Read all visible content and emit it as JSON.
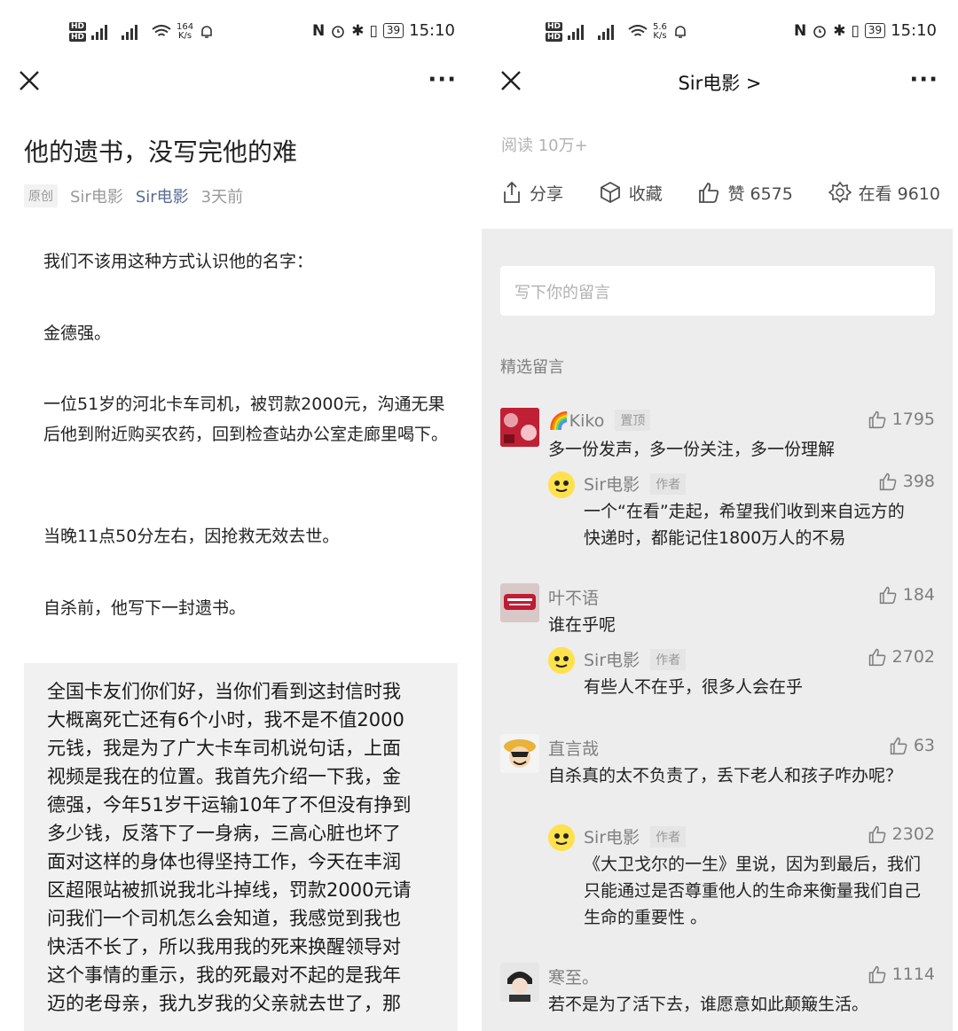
{
  "left": {
    "status": {
      "net_speed": "164",
      "net_unit": "K/s",
      "battery": "39",
      "time": "15:10"
    },
    "article": {
      "title": "他的遗书，没写完他的难",
      "original_tag": "原创",
      "author": "Sir电影",
      "account_link": "Sir电影",
      "time_ago": "3天前",
      "paragraphs": [
        "我们不该用这种方式认识他的名字：",
        "金德强。",
        "一位51岁的河北卡车司机，被罚款2000元，沟通无果后他到附近购买农药，回到检查站办公室走廊里喝下。",
        "当晚11点50分左右，因抢救无效去世。",
        "自杀前，他写下一封遗书。"
      ],
      "letter_lines": [
        "全国卡友们你们好，当你们看到这封信时我",
        "大概离死亡还有6个小时，我不是不值2000",
        "元钱，我是为了广大卡车司机说句话，上面",
        "视频是我在的位置。我首先介绍一下我，金",
        "德强，今年51岁干运输10年了不但没有挣到",
        "多少钱，反落下了一身病，三高心脏也坏了",
        "面对这样的身体也得坚持工作，今天在丰润",
        "区超限站被抓说我北斗掉线，罚款2000元请",
        "问我们一个司机怎么会知道，我感觉到我也",
        "快活不长了，所以我用我的死来换醒领导对",
        "这个事情的重示，我的死最对不起的是我年",
        "迈的老母亲，我九岁我的父亲就去世了，那"
      ]
    }
  },
  "right": {
    "status": {
      "net_speed": "5.6",
      "net_unit": "K/s",
      "battery": "39",
      "time": "15:10"
    },
    "nav_title": "Sir电影 >",
    "read_count": "阅读 10万+",
    "actions": {
      "share": "分享",
      "favorite": "收藏",
      "like": "赞 6575",
      "watching": "在看 9610"
    },
    "comment_placeholder": "写下你的留言",
    "section_title": "精选留言",
    "pin_label": "置顶",
    "author_label": "作者",
    "comments": [
      {
        "name": "🌈Kiko",
        "likes": "1795",
        "text": "多一份发声，多一份关注，多一份理解",
        "reply": {
          "name": "Sir电影",
          "likes": "398",
          "text": "一个“在看”走起，希望我们收到来自远方的快递时，都能记住1800万人的不易"
        }
      },
      {
        "name": "叶不语",
        "likes": "184",
        "text": "谁在乎呢",
        "reply": {
          "name": "Sir电影",
          "likes": "2702",
          "text": "有些人不在乎，很多人会在乎"
        }
      },
      {
        "name": "直言哉",
        "likes": "63",
        "text": "自杀真的太不负责了，丢下老人和孩子咋办呢？",
        "reply": {
          "name": "Sir电影",
          "likes": "2302",
          "text": "《大卫戈尔的一生》里说，因为到最后，我们只能通过是否尊重他人的生命来衡量我们自己生命的重要性 。"
        }
      },
      {
        "name": "寒至。",
        "likes": "1114",
        "text": "若不是为了活下去，谁愿意如此颠簸生活。"
      }
    ]
  }
}
